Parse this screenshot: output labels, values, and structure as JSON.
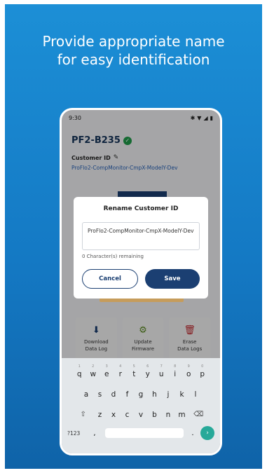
{
  "headline": {
    "line1": "Provide appropriate name",
    "line2": "for easy identification"
  },
  "status": {
    "time": "9:30",
    "icons": [
      "bluetooth-icon",
      "wifi-icon",
      "signal-icon",
      "battery-icon"
    ]
  },
  "app": {
    "device_title": "PF2-B235",
    "customer_id_label": "Customer ID",
    "customer_id_value": "ProFlo2-CompMonitor-CmpX-ModelY-Dev"
  },
  "tiles": [
    {
      "icon": "download-icon",
      "line1": "Download",
      "line2": "Data Log"
    },
    {
      "icon": "chip-icon",
      "line1": "Update",
      "line2": "Firmware"
    },
    {
      "icon": "trash-icon",
      "line1": "Erase",
      "line2": "Data Logs"
    }
  ],
  "dialog": {
    "title": "Rename Customer ID",
    "input_value": "ProFlo2-CompMonitor-CmpX-ModelY-Dev",
    "remaining_text": "0 Character(s) remaining",
    "cancel_label": "Cancel",
    "save_label": "Save"
  },
  "keyboard": {
    "row1": [
      "q",
      "w",
      "e",
      "r",
      "t",
      "y",
      "u",
      "i",
      "o",
      "p"
    ],
    "row1_hints": [
      "1",
      "2",
      "3",
      "4",
      "5",
      "6",
      "7",
      "8",
      "9",
      "0"
    ],
    "row2": [
      "a",
      "s",
      "d",
      "f",
      "g",
      "h",
      "j",
      "k",
      "l"
    ],
    "row3": [
      "z",
      "x",
      "c",
      "v",
      "b",
      "n",
      "m"
    ],
    "symbols_label": "?123",
    "comma": ",",
    "period": "."
  },
  "colors": {
    "background_top": "#1c8fd6",
    "background_bottom": "#0f63a8",
    "primary_navy": "#1b3f72",
    "success_green": "#1f9c4a",
    "link_blue": "#2862b8",
    "keyboard_go": "#27a999"
  }
}
